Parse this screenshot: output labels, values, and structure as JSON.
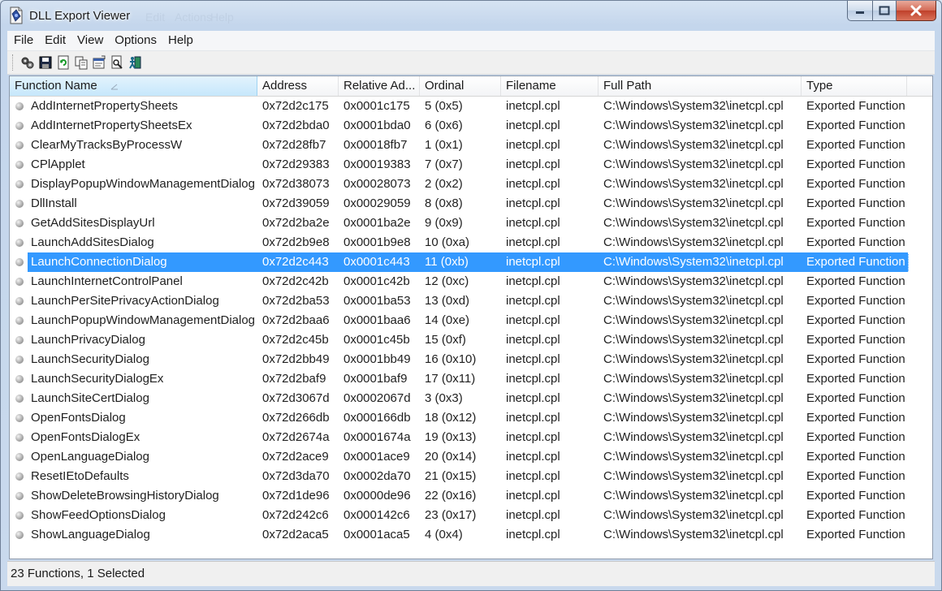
{
  "window": {
    "title": "DLL Export Viewer",
    "background_ghost_texts": [
      "Edit",
      "Actions",
      "Help"
    ]
  },
  "menu": [
    "File",
    "Edit",
    "View",
    "Options",
    "Help"
  ],
  "toolbar": {
    "icons": [
      "properties-icon",
      "save-icon",
      "refresh-icon",
      "copy-icon",
      "html-report-icon",
      "find-icon",
      "exit-icon"
    ]
  },
  "columns": [
    "Function Name",
    "Address",
    "Relative Ad...",
    "Ordinal",
    "Filename",
    "Full Path",
    "Type"
  ],
  "rows": [
    {
      "name": "AddInternetPropertySheets",
      "address": "0x72d2c175",
      "relative": "0x0001c175",
      "ordinal": "5 (0x5)",
      "filename": "inetcpl.cpl",
      "path": "C:\\Windows\\System32\\inetcpl.cpl",
      "type": "Exported Function"
    },
    {
      "name": "AddInternetPropertySheetsEx",
      "address": "0x72d2bda0",
      "relative": "0x0001bda0",
      "ordinal": "6 (0x6)",
      "filename": "inetcpl.cpl",
      "path": "C:\\Windows\\System32\\inetcpl.cpl",
      "type": "Exported Function"
    },
    {
      "name": "ClearMyTracksByProcessW",
      "address": "0x72d28fb7",
      "relative": "0x00018fb7",
      "ordinal": "1 (0x1)",
      "filename": "inetcpl.cpl",
      "path": "C:\\Windows\\System32\\inetcpl.cpl",
      "type": "Exported Function"
    },
    {
      "name": "CPlApplet",
      "address": "0x72d29383",
      "relative": "0x00019383",
      "ordinal": "7 (0x7)",
      "filename": "inetcpl.cpl",
      "path": "C:\\Windows\\System32\\inetcpl.cpl",
      "type": "Exported Function"
    },
    {
      "name": "DisplayPopupWindowManagementDialog",
      "address": "0x72d38073",
      "relative": "0x00028073",
      "ordinal": "2 (0x2)",
      "filename": "inetcpl.cpl",
      "path": "C:\\Windows\\System32\\inetcpl.cpl",
      "type": "Exported Function"
    },
    {
      "name": "DllInstall",
      "address": "0x72d39059",
      "relative": "0x00029059",
      "ordinal": "8 (0x8)",
      "filename": "inetcpl.cpl",
      "path": "C:\\Windows\\System32\\inetcpl.cpl",
      "type": "Exported Function"
    },
    {
      "name": "GetAddSitesDisplayUrl",
      "address": "0x72d2ba2e",
      "relative": "0x0001ba2e",
      "ordinal": "9 (0x9)",
      "filename": "inetcpl.cpl",
      "path": "C:\\Windows\\System32\\inetcpl.cpl",
      "type": "Exported Function"
    },
    {
      "name": "LaunchAddSitesDialog",
      "address": "0x72d2b9e8",
      "relative": "0x0001b9e8",
      "ordinal": "10 (0xa)",
      "filename": "inetcpl.cpl",
      "path": "C:\\Windows\\System32\\inetcpl.cpl",
      "type": "Exported Function"
    },
    {
      "name": "LaunchConnectionDialog",
      "address": "0x72d2c443",
      "relative": "0x0001c443",
      "ordinal": "11 (0xb)",
      "filename": "inetcpl.cpl",
      "path": "C:\\Windows\\System32\\inetcpl.cpl",
      "type": "Exported Function",
      "selected": true
    },
    {
      "name": "LaunchInternetControlPanel",
      "address": "0x72d2c42b",
      "relative": "0x0001c42b",
      "ordinal": "12 (0xc)",
      "filename": "inetcpl.cpl",
      "path": "C:\\Windows\\System32\\inetcpl.cpl",
      "type": "Exported Function"
    },
    {
      "name": "LaunchPerSitePrivacyActionDialog",
      "address": "0x72d2ba53",
      "relative": "0x0001ba53",
      "ordinal": "13 (0xd)",
      "filename": "inetcpl.cpl",
      "path": "C:\\Windows\\System32\\inetcpl.cpl",
      "type": "Exported Function"
    },
    {
      "name": "LaunchPopupWindowManagementDialog",
      "address": "0x72d2baa6",
      "relative": "0x0001baa6",
      "ordinal": "14 (0xe)",
      "filename": "inetcpl.cpl",
      "path": "C:\\Windows\\System32\\inetcpl.cpl",
      "type": "Exported Function"
    },
    {
      "name": "LaunchPrivacyDialog",
      "address": "0x72d2c45b",
      "relative": "0x0001c45b",
      "ordinal": "15 (0xf)",
      "filename": "inetcpl.cpl",
      "path": "C:\\Windows\\System32\\inetcpl.cpl",
      "type": "Exported Function"
    },
    {
      "name": "LaunchSecurityDialog",
      "address": "0x72d2bb49",
      "relative": "0x0001bb49",
      "ordinal": "16 (0x10)",
      "filename": "inetcpl.cpl",
      "path": "C:\\Windows\\System32\\inetcpl.cpl",
      "type": "Exported Function"
    },
    {
      "name": "LaunchSecurityDialogEx",
      "address": "0x72d2baf9",
      "relative": "0x0001baf9",
      "ordinal": "17 (0x11)",
      "filename": "inetcpl.cpl",
      "path": "C:\\Windows\\System32\\inetcpl.cpl",
      "type": "Exported Function"
    },
    {
      "name": "LaunchSiteCertDialog",
      "address": "0x72d3067d",
      "relative": "0x0002067d",
      "ordinal": "3 (0x3)",
      "filename": "inetcpl.cpl",
      "path": "C:\\Windows\\System32\\inetcpl.cpl",
      "type": "Exported Function"
    },
    {
      "name": "OpenFontsDialog",
      "address": "0x72d266db",
      "relative": "0x000166db",
      "ordinal": "18 (0x12)",
      "filename": "inetcpl.cpl",
      "path": "C:\\Windows\\System32\\inetcpl.cpl",
      "type": "Exported Function"
    },
    {
      "name": "OpenFontsDialogEx",
      "address": "0x72d2674a",
      "relative": "0x0001674a",
      "ordinal": "19 (0x13)",
      "filename": "inetcpl.cpl",
      "path": "C:\\Windows\\System32\\inetcpl.cpl",
      "type": "Exported Function"
    },
    {
      "name": "OpenLanguageDialog",
      "address": "0x72d2ace9",
      "relative": "0x0001ace9",
      "ordinal": "20 (0x14)",
      "filename": "inetcpl.cpl",
      "path": "C:\\Windows\\System32\\inetcpl.cpl",
      "type": "Exported Function"
    },
    {
      "name": "ResetIEtoDefaults",
      "address": "0x72d3da70",
      "relative": "0x0002da70",
      "ordinal": "21 (0x15)",
      "filename": "inetcpl.cpl",
      "path": "C:\\Windows\\System32\\inetcpl.cpl",
      "type": "Exported Function"
    },
    {
      "name": "ShowDeleteBrowsingHistoryDialog",
      "address": "0x72d1de96",
      "relative": "0x0000de96",
      "ordinal": "22 (0x16)",
      "filename": "inetcpl.cpl",
      "path": "C:\\Windows\\System32\\inetcpl.cpl",
      "type": "Exported Function"
    },
    {
      "name": "ShowFeedOptionsDialog",
      "address": "0x72d242c6",
      "relative": "0x000142c6",
      "ordinal": "23 (0x17)",
      "filename": "inetcpl.cpl",
      "path": "C:\\Windows\\System32\\inetcpl.cpl",
      "type": "Exported Function"
    },
    {
      "name": "ShowLanguageDialog",
      "address": "0x72d2aca5",
      "relative": "0x0001aca5",
      "ordinal": "4 (0x4)",
      "filename": "inetcpl.cpl",
      "path": "C:\\Windows\\System32\\inetcpl.cpl",
      "type": "Exported Function"
    }
  ],
  "status": "23 Functions, 1 Selected",
  "colors": {
    "selection": "#3399ff",
    "sorted_header": "#c6e7fb",
    "close_button": "#c0402a"
  }
}
